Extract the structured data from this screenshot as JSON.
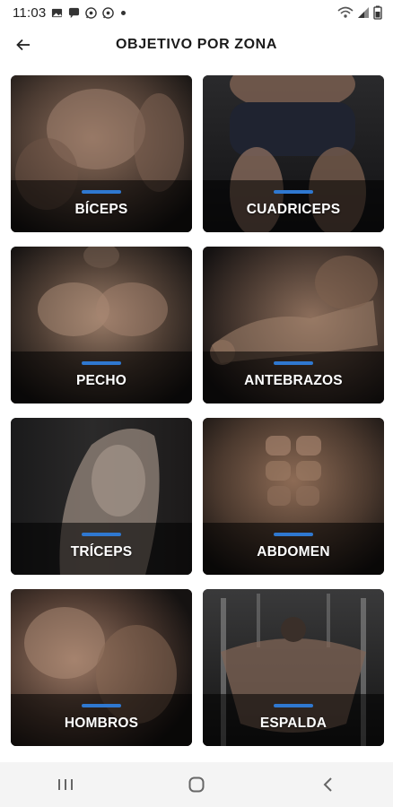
{
  "status_bar": {
    "time": "11:03",
    "icons": [
      "image-icon",
      "message-icon",
      "whatsapp-icon",
      "whatsapp-icon",
      "dot-icon",
      "wifi-icon",
      "signal-icon",
      "battery-icon"
    ]
  },
  "header": {
    "title": "OBJETIVO POR ZONA",
    "back_icon": "arrow-left-icon"
  },
  "cards": [
    {
      "label": "BÍCEPS"
    },
    {
      "label": "CUADRICEPS"
    },
    {
      "label": "PECHO"
    },
    {
      "label": "ANTEBRAZOS"
    },
    {
      "label": "TRÍCEPS"
    },
    {
      "label": "ABDOMEN"
    },
    {
      "label": "HOMBROS"
    },
    {
      "label": "ESPALDA"
    }
  ],
  "colors": {
    "accent": "#2f78d0",
    "card_bg": "#1b1b1b",
    "nav_bg": "#f4f4f4"
  },
  "system_nav": {
    "icons": [
      "recent-apps-icon",
      "home-icon",
      "back-icon"
    ]
  }
}
